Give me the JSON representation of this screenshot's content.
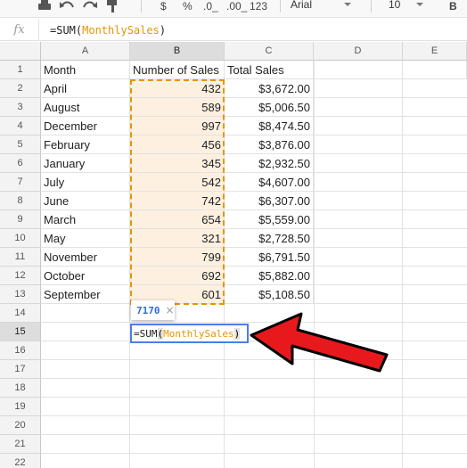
{
  "toolbar": {
    "currency_label": "$",
    "percent_label": "%",
    "decrease_decimals_label": ".0_",
    "increase_decimals_label": ".00_",
    "more_formats_label": "123",
    "font_name": "Arial",
    "font_size": "10",
    "bold_label": "B"
  },
  "formula_bar": {
    "fx_label": "fx",
    "function_text": "=SUM(",
    "range_text": "MonthlySales",
    "close_text": ")"
  },
  "columns": [
    "A",
    "B",
    "C",
    "D",
    "E"
  ],
  "rows": [
    "1",
    "2",
    "3",
    "4",
    "5",
    "6",
    "7",
    "8",
    "9",
    "10",
    "11",
    "12",
    "13",
    "14",
    "15",
    "16",
    "17",
    "18",
    "19",
    "20",
    "21",
    "22"
  ],
  "sheet": {
    "headers": [
      "Month",
      "Number of Sales",
      "Total Sales"
    ],
    "records": [
      {
        "month": "April",
        "sales": "432",
        "total": "$3,672.00"
      },
      {
        "month": "August",
        "sales": "589",
        "total": "$5,006.50"
      },
      {
        "month": "December",
        "sales": "997",
        "total": "$8,474.50"
      },
      {
        "month": "February",
        "sales": "456",
        "total": "$3,876.00"
      },
      {
        "month": "January",
        "sales": "345",
        "total": "$2,932.50"
      },
      {
        "month": "July",
        "sales": "542",
        "total": "$4,607.00"
      },
      {
        "month": "June",
        "sales": "742",
        "total": "$6,307.00"
      },
      {
        "month": "March",
        "sales": "654",
        "total": "$5,559.00"
      },
      {
        "month": "May",
        "sales": "321",
        "total": "$2,728.50"
      },
      {
        "month": "November",
        "sales": "799",
        "total": "$6,791.50"
      },
      {
        "month": "October",
        "sales": "692",
        "total": "$5,882.00"
      },
      {
        "month": "September",
        "sales": "601",
        "total": "$5,108.50"
      }
    ]
  },
  "result_tooltip": {
    "value": "7170",
    "close_glyph": "×"
  },
  "cell_editor": {
    "function_text": "=SUM",
    "open_paren": "(",
    "range_text": "MonthlySales",
    "close_paren": ")"
  },
  "colors": {
    "range_highlight": "#e69500",
    "range_fill": "#fdf0e0",
    "editor_border": "#4a7de8",
    "arrow_red": "#e8191c"
  },
  "icons": [
    "print-icon",
    "undo-icon",
    "redo-icon",
    "paint-format-icon",
    "dropdown-caret-icon",
    "annotation-arrow-icon"
  ]
}
